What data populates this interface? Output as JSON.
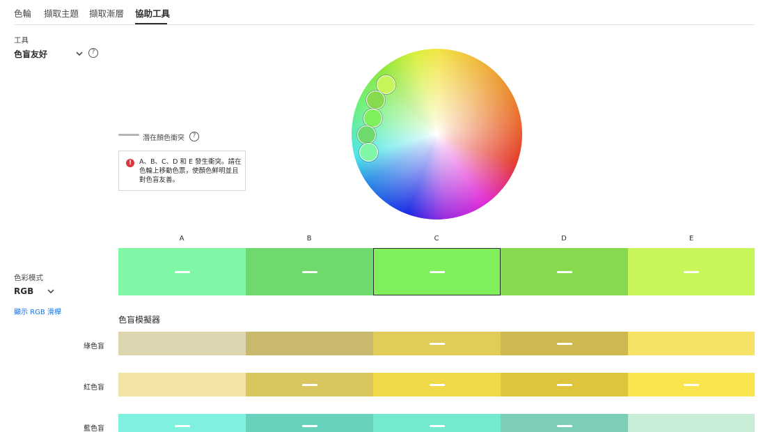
{
  "tabs": [
    {
      "label": "色輪",
      "active": false
    },
    {
      "label": "擷取主題",
      "active": false
    },
    {
      "label": "擷取漸層",
      "active": false
    },
    {
      "label": "協助工具",
      "active": true
    }
  ],
  "tool": {
    "label": "工具",
    "value": "色盲友好",
    "help_icon": "?"
  },
  "conflict_legend": {
    "text": "潛在顏色衝突",
    "help_icon": "?"
  },
  "warning": {
    "icon": "!",
    "text": "A、B、C、D 和 E 發生衝突。請在色輪上移動色票，使顏色鮮明並且對色盲友善。"
  },
  "color_mode": {
    "label": "色彩模式",
    "value": "RGB",
    "show_sliders_link": "顯示 RGB 滑桿"
  },
  "swatches": [
    {
      "label": "A",
      "color": "#7ff7a7",
      "conflict": true
    },
    {
      "label": "B",
      "color": "#6fd96d",
      "conflict": true
    },
    {
      "label": "C",
      "color": "#80ef5c",
      "conflict": true,
      "selected": true
    },
    {
      "label": "D",
      "color": "#87d94e",
      "conflict": true
    },
    {
      "label": "E",
      "color": "#c8f55a",
      "conflict": true
    }
  ],
  "simulator": {
    "title": "色盲模擬器",
    "rows": [
      {
        "label": "綠色盲",
        "colors": [
          "#dcd5b0",
          "#c8b96c",
          "#e1cc5a",
          "#cdb94f",
          "#f6e264"
        ],
        "conflicts": [
          false,
          false,
          true,
          true,
          false
        ]
      },
      {
        "label": "紅色盲",
        "colors": [
          "#f2e3a7",
          "#d9c65f",
          "#f1da4a",
          "#dec53d",
          "#fbe54f"
        ],
        "conflicts": [
          false,
          true,
          true,
          true,
          true
        ]
      },
      {
        "label": "藍色盲",
        "colors": [
          "#7ff2df",
          "#69d2bd",
          "#73e9cf",
          "#7cceb6",
          "#c9ecd6"
        ],
        "conflicts": [
          true,
          true,
          true,
          true,
          false
        ]
      }
    ]
  },
  "wheel_handles": [
    {
      "color": "#c8f55a"
    },
    {
      "color": "#87d94e"
    },
    {
      "color": "#80ef5c"
    },
    {
      "color": "#6fd96d"
    },
    {
      "color": "#7ff7a7"
    }
  ]
}
